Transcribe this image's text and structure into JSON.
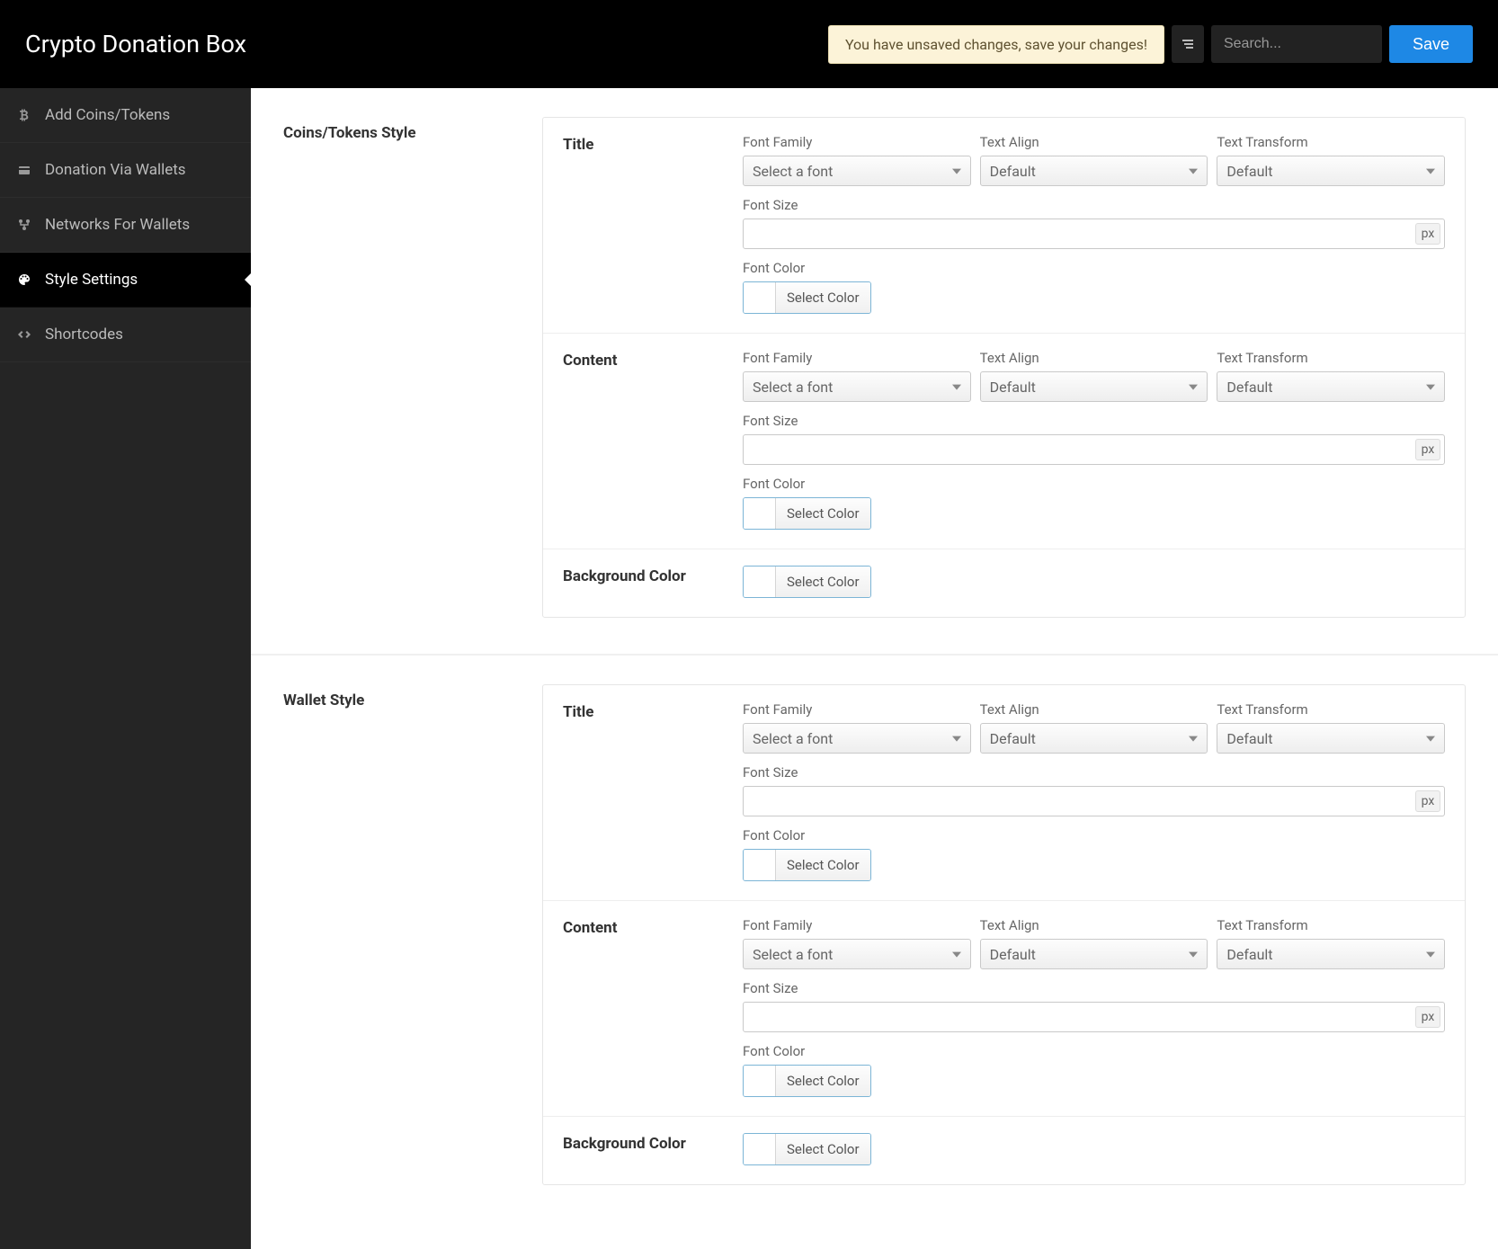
{
  "header": {
    "title": "Crypto Donation Box",
    "unsaved_message": "You have unsaved changes, save your changes!",
    "search_placeholder": "Search...",
    "save_label": "Save"
  },
  "sidebar": {
    "items": [
      {
        "label": "Add Coins/Tokens",
        "icon": "bitcoin-icon",
        "active": false
      },
      {
        "label": "Donation Via Wallets",
        "icon": "wallet-icon",
        "active": false
      },
      {
        "label": "Networks For Wallets",
        "icon": "network-icon",
        "active": false
      },
      {
        "label": "Style Settings",
        "icon": "palette-icon",
        "active": true
      },
      {
        "label": "Shortcodes",
        "icon": "code-icon",
        "active": false
      }
    ]
  },
  "common": {
    "font_family_label": "Font Family",
    "text_align_label": "Text Align",
    "text_transform_label": "Text Transform",
    "font_size_label": "Font Size",
    "font_color_label": "Font Color",
    "font_family_placeholder": "Select a font",
    "default_placeholder": "Default",
    "px_suffix": "px",
    "select_color_label": "Select Color"
  },
  "sections": [
    {
      "title": "Coins/Tokens Style",
      "rows": [
        {
          "type": "typography",
          "label": "Title"
        },
        {
          "type": "typography",
          "label": "Content"
        },
        {
          "type": "bgcolor",
          "label": "Background Color"
        }
      ]
    },
    {
      "title": "Wallet Style",
      "rows": [
        {
          "type": "typography",
          "label": "Title"
        },
        {
          "type": "typography",
          "label": "Content"
        },
        {
          "type": "bgcolor",
          "label": "Background Color"
        }
      ]
    }
  ]
}
